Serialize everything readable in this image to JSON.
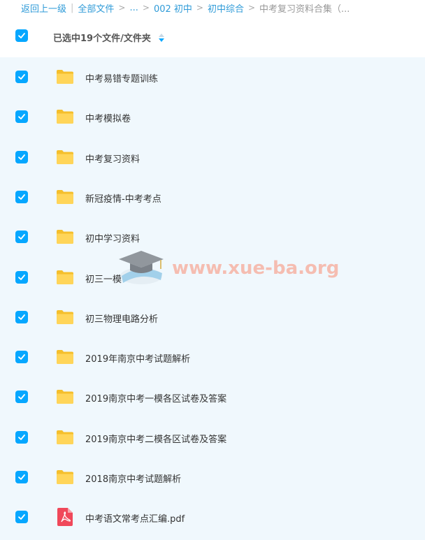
{
  "breadcrumb": {
    "back": "返回上一级",
    "all_files": "全部文件",
    "ellipsis": "...",
    "path1": "002 初中",
    "path2": "初中综合",
    "current": "中考复习资料合集（..."
  },
  "header": {
    "title": "已选中19个文件/文件夹"
  },
  "files": [
    {
      "name": "中考易错专题训练",
      "type": "folder"
    },
    {
      "name": "中考模拟卷",
      "type": "folder"
    },
    {
      "name": "中考复习资料",
      "type": "folder"
    },
    {
      "name": "新冠疫情-中考考点",
      "type": "folder"
    },
    {
      "name": "初中学习资料",
      "type": "folder"
    },
    {
      "name": "初三一模",
      "type": "folder"
    },
    {
      "name": "初三物理电路分析",
      "type": "folder"
    },
    {
      "name": "2019年南京中考试题解析",
      "type": "folder"
    },
    {
      "name": "2019南京中考一模各区试卷及答案",
      "type": "folder"
    },
    {
      "name": "2019南京中考二模各区试卷及答案",
      "type": "folder"
    },
    {
      "name": "2018南京中考试题解析",
      "type": "folder"
    },
    {
      "name": "中考语文常考点汇编.pdf",
      "type": "pdf"
    }
  ],
  "watermark": "www.xue-ba.org",
  "colors": {
    "accent": "#06a7ff",
    "link": "#2f9bd8",
    "folder": "#ffd04a",
    "pdf": "#f0485a",
    "list_bg": "#f0f8fd"
  }
}
